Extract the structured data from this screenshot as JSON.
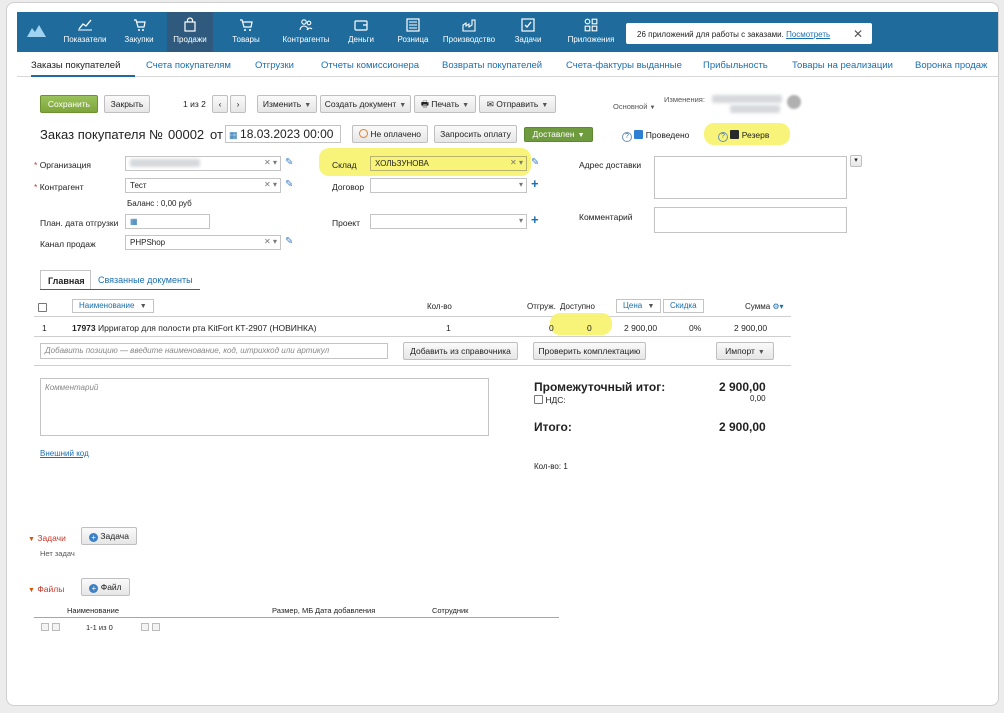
{
  "nav": {
    "items": [
      {
        "label": "Показатели",
        "icon": "chart-icon"
      },
      {
        "label": "Закупки",
        "icon": "cart-down-icon"
      },
      {
        "label": "Продажи",
        "icon": "bag-icon"
      },
      {
        "label": "Товары",
        "icon": "cart-icon"
      },
      {
        "label": "Контрагенты",
        "icon": "people-icon"
      },
      {
        "label": "Деньги",
        "icon": "wallet-icon"
      },
      {
        "label": "Розница",
        "icon": "register-icon"
      },
      {
        "label": "Производство",
        "icon": "factory-icon"
      },
      {
        "label": "Задачи",
        "icon": "check-icon"
      },
      {
        "label": "Приложения",
        "icon": "apps-icon"
      }
    ],
    "active_index": 2,
    "notification_text": "26 приложений для работы с заказами.",
    "notification_link": "Посмотреть"
  },
  "subnav": [
    "Заказы покупателей",
    "Счета покупателям",
    "Отгрузки",
    "Отчеты комиссионера",
    "Возвраты покупателей",
    "Счета-фактуры выданные",
    "Прибыльность",
    "Товары на реализации",
    "Воронка продаж"
  ],
  "toolbar": {
    "save": "Сохранить",
    "close": "Закрыть",
    "pager": "1 из 2",
    "edit": "Изменить",
    "create_doc": "Создать документ",
    "print": "Печать",
    "send": "Отправить",
    "main_label": "Основной",
    "changes_label": "Изменения:"
  },
  "doc": {
    "title": "Заказ покупателя №",
    "number": "00002",
    "from": "от",
    "date": "18.03.2023 00:00",
    "unpaid": "Не оплачено",
    "request_payment": "Запросить оплату",
    "status": "Доставлен",
    "posted": "Проведено",
    "reserve": "Резерв"
  },
  "form": {
    "org_label": "Организация",
    "counterparty_label": "Контрагент",
    "counterparty_value": "Тест",
    "balance": "Баланс : 0,00 руб",
    "ship_date_label": "План. дата отгрузки",
    "channel_label": "Канал продаж",
    "channel_value": "PHPShop",
    "warehouse_label": "Склад",
    "warehouse_value": "ХОЛЬЗУНОВА",
    "contract_label": "Договор",
    "project_label": "Проект",
    "delivery_label": "Адрес доставки",
    "comment_label": "Комментарий"
  },
  "tabs": [
    "Главная",
    "Связанные документы"
  ],
  "table": {
    "headers": {
      "name": "Наименование",
      "qty": "Кол-во",
      "shipped": "Отгруж.",
      "available": "Доступно",
      "price": "Цена",
      "discount": "Скидка",
      "sum": "Сумма"
    },
    "rows": [
      {
        "n": "1",
        "code": "17973",
        "name": "Ирригатор для полости рта KitFort КТ-2907 (НОВИНКА)",
        "qty": "1",
        "shipped": "0",
        "available": "0",
        "price": "2 900,00",
        "discount": "0%",
        "sum": "2 900,00"
      }
    ],
    "add_placeholder": "Добавить позицию — введите наименование, код, штрихкод или артикул",
    "add_from_catalog": "Добавить из справочника",
    "check_kit": "Проверить комплектацию",
    "import": "Импорт"
  },
  "totals": {
    "comment_placeholder": "Комментарий",
    "external_code": "Внешний код",
    "subtotal_label": "Промежуточный итог:",
    "subtotal_value": "2 900,00",
    "vat_label": "НДС:",
    "vat_value": "0,00",
    "total_label": "Итого:",
    "total_value": "2 900,00",
    "count": "Кол-во: 1"
  },
  "tasks": {
    "title": "Задачи",
    "button": "Задача",
    "empty": "Нет задач"
  },
  "files": {
    "title": "Файлы",
    "button": "Файл",
    "headers": {
      "name": "Наименование",
      "size": "Размер, МБ",
      "date": "Дата добавления",
      "employee": "Сотрудник"
    },
    "pager": "1-1 из 0"
  },
  "colors": {
    "nav": "#1f6c9c",
    "highlight": "#f7f36c",
    "link": "#1a6fb0",
    "green": "#7da53b"
  }
}
